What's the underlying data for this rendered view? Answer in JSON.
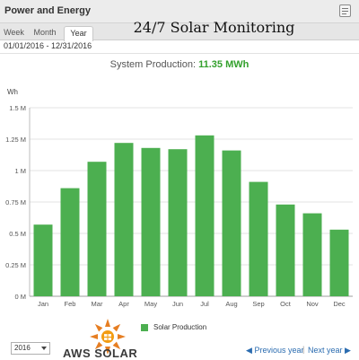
{
  "app": {
    "title": "Power and Energy",
    "banner": "24/7 Solar Monitoring"
  },
  "tabs": [
    {
      "label": "Week",
      "active": false
    },
    {
      "label": "Month",
      "active": false
    },
    {
      "label": "Year",
      "active": true
    }
  ],
  "date_range": "01/01/2016 - 12/31/2016",
  "production": {
    "label": "System Production:",
    "value": "11.35 MWh",
    "value_color": "#33a02c"
  },
  "chart_data": {
    "type": "bar",
    "ylabel": "Wh",
    "ylim": [
      0,
      1.5
    ],
    "unit_scale": "millions",
    "y_ticks": [
      {
        "value": 0,
        "label": "0 M"
      },
      {
        "value": 0.25,
        "label": "0.25 M"
      },
      {
        "value": 0.5,
        "label": "0.5 M"
      },
      {
        "value": 0.75,
        "label": "0.75 M"
      },
      {
        "value": 1,
        "label": "1 M"
      },
      {
        "value": 1.25,
        "label": "1.25 M"
      },
      {
        "value": 1.5,
        "label": "1.5 M"
      }
    ],
    "categories": [
      "Jan",
      "Feb",
      "Mar",
      "Apr",
      "May",
      "Jun",
      "Jul",
      "Aug",
      "Sep",
      "Oct",
      "Nov",
      "Dec"
    ],
    "series": [
      {
        "name": "Solar Production",
        "color": "#4caf50",
        "values": [
          0.57,
          0.86,
          1.07,
          1.22,
          1.18,
          1.17,
          1.28,
          1.16,
          0.91,
          0.73,
          0.66,
          0.53
        ]
      }
    ],
    "grid": true,
    "legend_position": "bottom"
  },
  "logo": {
    "text": "AWS SOLAR",
    "icon": "sun-logo-icon",
    "colors": [
      "#f39c12",
      "#e67e22"
    ]
  },
  "footer": {
    "year_select": "2016",
    "prev_label": "Previous year",
    "next_label": "Next year",
    "link_color": "#2b6cb0"
  }
}
